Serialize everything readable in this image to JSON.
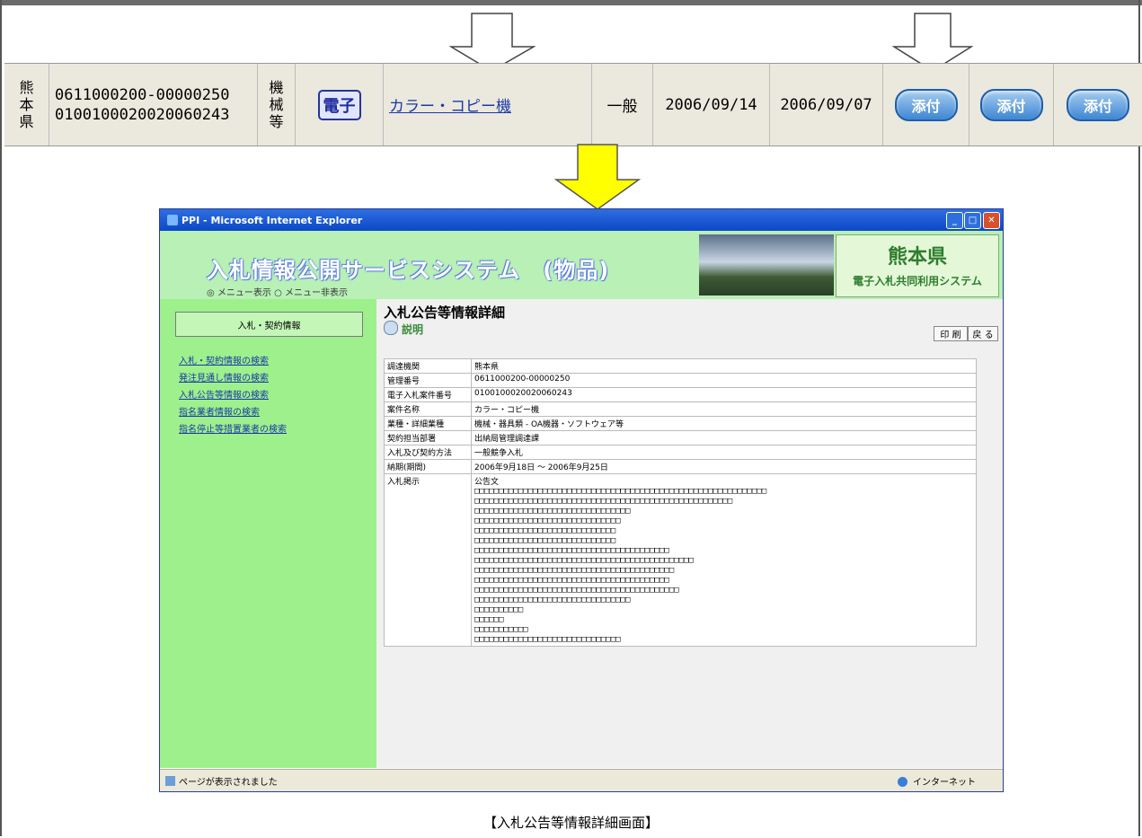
{
  "row": {
    "prefecture_chars": [
      "熊",
      "本",
      "県"
    ],
    "mgmt_no": "0611000200-00000250",
    "case_no": "0100100020020060243",
    "category_chars": [
      "機",
      "械",
      "等"
    ],
    "denshi_label": "電子",
    "item_name": "カラー・コピー機",
    "type": "一般",
    "date1": "2006/09/14",
    "date2": "2006/09/07",
    "attach_labels": [
      "添付",
      "添付",
      "添付"
    ]
  },
  "window": {
    "title": "PPI - Microsoft Internet Explorer",
    "header_title": "入札情報公開サービスシステム　(物品)",
    "radio_text": "◎ メニュー表示 ○ メニュー非表示",
    "pref_name": "熊本県",
    "pref_sub": "電子入札共同利用システム",
    "side_button": "入札・契約情報",
    "side_links": [
      "入札・契約情報の検索",
      "発注見通し情報の検索",
      "入札公告等情報の検索",
      "指名業者情報の検索",
      "指名停止等措置業者の検索"
    ],
    "main_title": "入札公告等情報詳細",
    "tab_label": "説明",
    "print_label": "印 刷",
    "back_label": "戻 る",
    "details": [
      {
        "k": "調達機関",
        "v": "熊本県"
      },
      {
        "k": "管理番号",
        "v": "0611000200-00000250"
      },
      {
        "k": "電子入札案件番号",
        "v": "0100100020020060243"
      },
      {
        "k": "案件名称",
        "v": "カラー・コピー機"
      },
      {
        "k": "業種・詳細業種",
        "v": "機械・器具類 - OA機器・ソフトウェア等"
      },
      {
        "k": "契約担当部署",
        "v": "出納局管理調達課"
      },
      {
        "k": "入札及び契約方法",
        "v": "一般競争入札"
      },
      {
        "k": "納期(期間)",
        "v": "2006年9月18日 ～ 2006年9月25日"
      }
    ],
    "notice_key": "入札掲示",
    "notice_head": "公告文",
    "status_left": "ページが表示されました",
    "status_right": "インターネット"
  },
  "caption": "【入札公告等情報詳細画面】"
}
